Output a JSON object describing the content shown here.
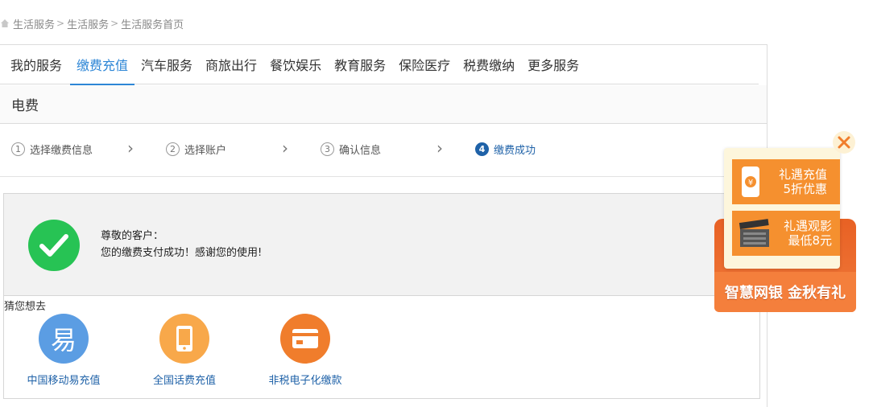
{
  "breadcrumb": {
    "items": [
      "生活服务",
      "生活服务",
      "生活服务首页"
    ],
    "separator": ">"
  },
  "tabs": [
    {
      "label": "我的服务"
    },
    {
      "label": "缴费充值",
      "active": true
    },
    {
      "label": "汽车服务"
    },
    {
      "label": "商旅出行"
    },
    {
      "label": "餐饮娱乐"
    },
    {
      "label": "教育服务"
    },
    {
      "label": "保险医疗"
    },
    {
      "label": "税费缴纳"
    },
    {
      "label": "更多服务"
    }
  ],
  "section": {
    "title": "电费"
  },
  "steps": [
    {
      "num": "1",
      "label": "选择缴费信息"
    },
    {
      "num": "2",
      "label": "选择账户"
    },
    {
      "num": "3",
      "label": "确认信息"
    },
    {
      "num": "4",
      "label": "缴费成功",
      "current": true
    }
  ],
  "result": {
    "greeting": "尊敬的客户：",
    "message": "您的缴费支付成功！感谢您的使用!"
  },
  "suggest": {
    "title": "猜您想去",
    "items": [
      {
        "label": "中国移动易充值",
        "icon": "yi-icon",
        "glyph": "易",
        "color": "#5b9de3"
      },
      {
        "label": "全国话费充值",
        "icon": "phone-icon",
        "color": "#f8a84a"
      },
      {
        "label": "非税电子化缴款",
        "icon": "card-icon",
        "color": "#f07d2c"
      }
    ]
  },
  "promo": {
    "items": [
      {
        "line1": "礼遇充值",
        "line2": "5折优惠",
        "icon": "phone-coin-icon"
      },
      {
        "line1": "礼遇观影",
        "line2": "最低8元",
        "icon": "clapperboard-icon"
      }
    ],
    "banner": "智慧网银 金秋有礼"
  },
  "colors": {
    "accent": "#2d86d6",
    "success": "#27c354",
    "step_active": "#1f62a8",
    "promo_orange": "#f5902f"
  }
}
